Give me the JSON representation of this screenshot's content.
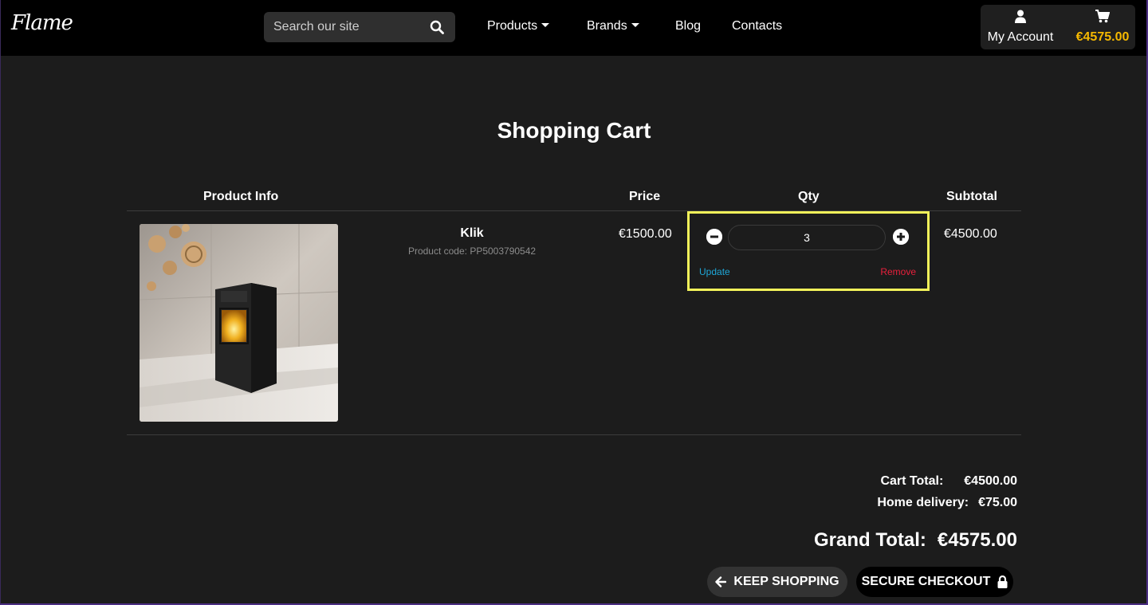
{
  "header": {
    "logo": "Flame",
    "search": {
      "placeholder": "Search our site"
    },
    "nav": {
      "products": "Products",
      "brands": "Brands",
      "blog": "Blog",
      "contacts": "Contacts"
    },
    "account_label": "My Account",
    "cart_total": "€4575.00",
    "cart_total_color": "#f5b800"
  },
  "cart": {
    "title": "Shopping Cart",
    "columns": {
      "product_info": "Product Info",
      "price": "Price",
      "qty": "Qty",
      "subtotal": "Subtotal"
    },
    "items": [
      {
        "name": "Klik",
        "product_code": "Product code: PP5003790542",
        "price": "€1500.00",
        "qty": "3",
        "subtotal": "€4500.00",
        "update_label": "Update",
        "remove_label": "Remove",
        "image_icon": "pellet-stove-image"
      }
    ],
    "totals": {
      "cart_total_label": "Cart Total:",
      "cart_total_value": "€4500.00",
      "delivery_label": "Home delivery:",
      "delivery_value": "€75.00",
      "grand_total_label": "Grand Total:",
      "grand_total_value": "€4575.00"
    },
    "buttons": {
      "keep_shopping": "KEEP SHOPPING",
      "secure_checkout": "SECURE CHECKOUT"
    }
  },
  "colors": {
    "background": "#1c1c1c",
    "header": "#000000",
    "highlight": "#f2f25a",
    "update_link": "#1ea7d8",
    "remove_link": "#e8203c"
  }
}
